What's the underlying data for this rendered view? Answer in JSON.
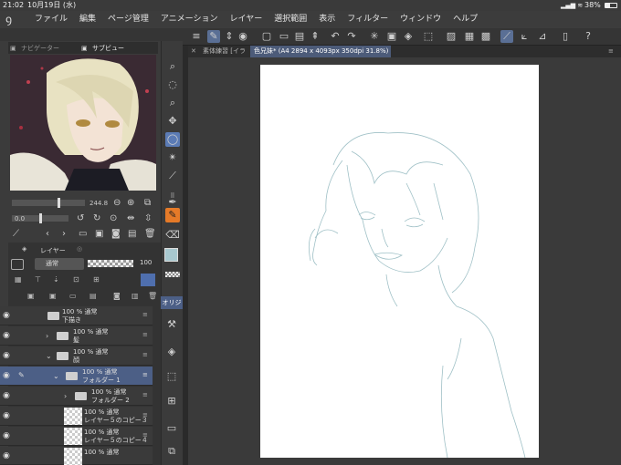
{
  "status": {
    "time": "21:02",
    "date": "10月19日 (水)",
    "battery": "38%"
  },
  "menu": [
    "ファイル",
    "編集",
    "ページ管理",
    "アニメーション",
    "レイヤー",
    "選択範囲",
    "表示",
    "フィルター",
    "ウィンドウ",
    "ヘルプ"
  ],
  "tabs": [
    {
      "label": "素体練習 [イラ"
    },
    {
      "label": "色兄妹* (A4 2894 x 4093px 350dpi 31.8%)"
    }
  ],
  "navigator": {
    "tab1": "ナビゲーター",
    "tab2": "サブビュー",
    "zoom": "244.8",
    "rotation": "0.0"
  },
  "layer_panel": {
    "tab": "レイヤー",
    "blend": "通常",
    "opacity": "100",
    "palette_label": "オリジ"
  },
  "layers": [
    {
      "line1": "100 % 通常",
      "line2": "下描き"
    },
    {
      "line1": "100 % 通常",
      "line2": "髪"
    },
    {
      "line1": "100 % 通常",
      "line2": "顔"
    },
    {
      "line1": "100 % 通常",
      "line2": "フォルダー 1"
    },
    {
      "line1": "100 % 通常",
      "line2": "フォルダー 2"
    },
    {
      "line1": "100 % 通常",
      "line2": "レイヤー５のコピー３"
    },
    {
      "line1": "100 % 通常",
      "line2": "レイヤー５のコピー４"
    },
    {
      "line1": "100 % 通常",
      "line2": ""
    }
  ]
}
